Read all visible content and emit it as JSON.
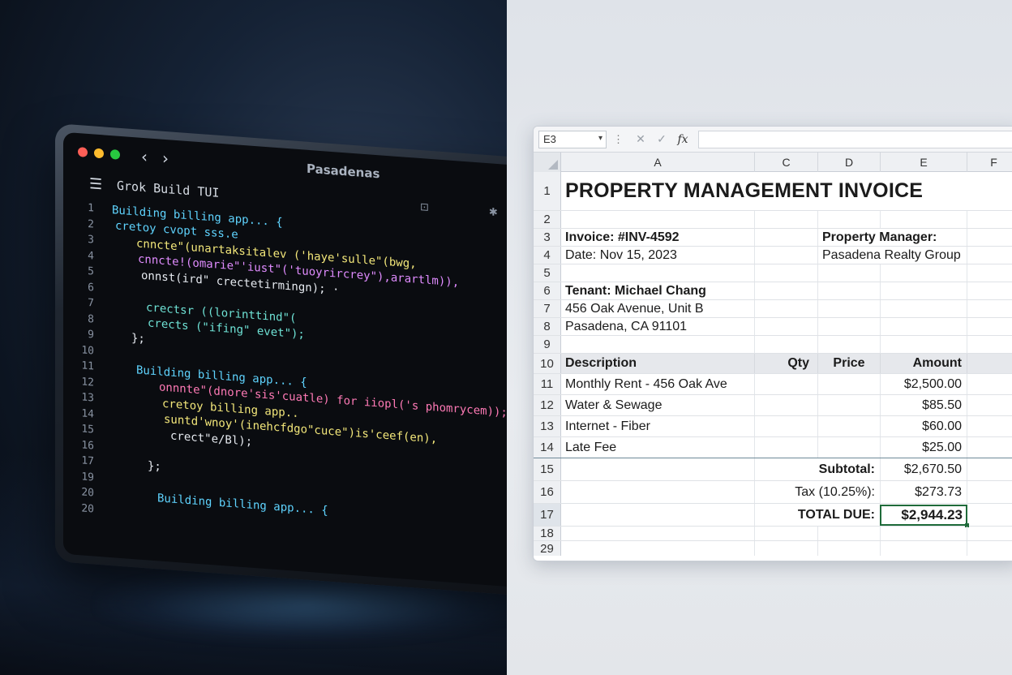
{
  "terminal": {
    "window_title": "Pasadenas",
    "nav_back": "‹",
    "nav_forward": "›",
    "tui_title": "Grok Build TUI",
    "lines": [
      {
        "n": "1",
        "text": "Building billing app... {",
        "color": "c-cyan",
        "indent": 0
      },
      {
        "n": "2",
        "text": "cretoy cvopt sss.e",
        "color": "c-cyan",
        "indent": 4
      },
      {
        "n": "3",
        "text": "cnncte\"(unartaksitalev ('haye'sulle\"(bwg,",
        "color": "c-yellow",
        "indent": 30
      },
      {
        "n": "4",
        "text": "cnncte!(omarie\"'iust\"('tuoyrircrey\"),arartlm)),",
        "color": "c-magenta",
        "indent": 32
      },
      {
        "n": "5",
        "text": "onnst(ird\" crectetirmingn); ·",
        "color": "c-white",
        "indent": 36
      },
      {
        "n": "6",
        "text": "",
        "color": "c-white",
        "indent": 0
      },
      {
        "n": "7",
        "text": "crectsr ((lorinttind\"(",
        "color": "c-teal",
        "indent": 42
      },
      {
        "n": "8",
        "text": "crects (\"ifing\" evet\");",
        "color": "c-teal",
        "indent": 44
      },
      {
        "n": "9",
        "text": "};",
        "color": "c-white",
        "indent": 24
      },
      {
        "n": "10",
        "text": "",
        "color": "c-white",
        "indent": 0
      },
      {
        "n": "11",
        "text": "Building billing app... {",
        "color": "c-cyan",
        "indent": 30
      },
      {
        "n": "12",
        "text": "onnnte\"(dnore'sis'cuatle) for iiopl('s phomrycem));",
        "color": "c-pink",
        "indent": 58
      },
      {
        "n": "13",
        "text": "cretoy billing app..",
        "color": "c-yellow",
        "indent": 62
      },
      {
        "n": "14",
        "text": "suntd'wnoy'(inehcfdgo\"cuce\")is'ceef(en),",
        "color": "c-yellow",
        "indent": 64
      },
      {
        "n": "15",
        "text": "crect\"e/Bl);",
        "color": "c-white",
        "indent": 72
      },
      {
        "n": "16",
        "text": "",
        "color": "c-white",
        "indent": 0
      },
      {
        "n": "17",
        "text": "};",
        "color": "c-white",
        "indent": 44
      },
      {
        "n": "19",
        "text": "",
        "color": "c-white",
        "indent": 0
      },
      {
        "n": "20",
        "text": "Building billing app... {",
        "color": "c-cyan",
        "indent": 56
      },
      {
        "n": "20",
        "text": "",
        "color": "c-white",
        "indent": 0
      }
    ]
  },
  "spreadsheet": {
    "name_box": "E3",
    "columns": [
      "A",
      "C",
      "D",
      "E",
      "F"
    ],
    "rows": {
      "r1": {
        "num": "1",
        "title": "PROPERTY MANAGEMENT INVOICE"
      },
      "r2": {
        "num": "2"
      },
      "r3": {
        "num": "3",
        "a": "Invoice: #INV-4592",
        "d": "Property Manager:"
      },
      "r4": {
        "num": "4",
        "a": "Date: Nov 15, 2023",
        "d": "Pasadena Realty Group"
      },
      "r5": {
        "num": "5"
      },
      "r6": {
        "num": "6",
        "a": "Tenant: Michael Chang"
      },
      "r7": {
        "num": "7",
        "a": "456 Oak Avenue, Unit B"
      },
      "r8": {
        "num": "8",
        "a": "Pasadena, CA 91101"
      },
      "r9": {
        "num": "9"
      },
      "r10": {
        "num": "10",
        "a": "Description",
        "c": "Qty",
        "d": "Price",
        "e": "Amount"
      },
      "r11": {
        "num": "11",
        "a": "Monthly Rent - 456 Oak Ave",
        "e": "$2,500.00"
      },
      "r12": {
        "num": "12",
        "a": "Water & Sewage",
        "e": "$85.50"
      },
      "r13": {
        "num": "13",
        "a": "Internet - Fiber",
        "e": "$60.00"
      },
      "r14": {
        "num": "14",
        "a": "Late Fee",
        "e": "$25.00"
      },
      "r15": {
        "num": "15",
        "d": "Subtotal:",
        "e": "$2,670.50"
      },
      "r16": {
        "num": "16",
        "d": "Tax (10.25%):",
        "e": "$273.73"
      },
      "r17": {
        "num": "17",
        "d": "TOTAL DUE:",
        "e": "$2,944.23"
      },
      "r18": {
        "num": "18"
      },
      "r29": {
        "num": "29"
      }
    }
  }
}
